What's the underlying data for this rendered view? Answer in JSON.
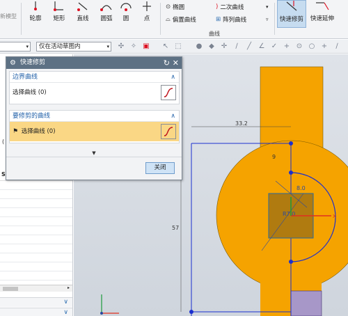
{
  "ribbon": {
    "left_label": "新模型",
    "buttons": [
      {
        "label": "轮廓",
        "icon": "profile-icon"
      },
      {
        "label": "矩形",
        "icon": "rectangle-icon"
      },
      {
        "label": "直线",
        "icon": "line-icon"
      },
      {
        "label": "圆弧",
        "icon": "arc-icon"
      },
      {
        "label": "圆",
        "icon": "circle-icon"
      },
      {
        "label": "点",
        "icon": "point-icon"
      }
    ],
    "small_items": [
      {
        "label": "椭圆",
        "icon": "ellipse-icon"
      },
      {
        "label": "偏置曲线",
        "icon": "offset-curve-icon"
      },
      {
        "label": "二次曲线",
        "icon": "conic-icon"
      },
      {
        "label": "阵列曲线",
        "icon": "pattern-curve-icon"
      }
    ],
    "group_label": "曲线",
    "right_buttons": [
      {
        "label": "快速修剪",
        "icon": "quick-trim-icon",
        "active": true
      },
      {
        "label": "快速延伸",
        "icon": "quick-extend-icon",
        "active": false
      }
    ]
  },
  "toolbar": {
    "filter_value": "仅在活动草图内"
  },
  "left_panel": {
    "stub_text": "(",
    "header_text": "SK"
  },
  "dialog": {
    "title": "快速修剪",
    "sections": [
      {
        "title": "边界曲线",
        "row_label": "选择曲线 (0)"
      },
      {
        "title": "要修剪的曲线",
        "row_label": "选择曲线 (0)"
      }
    ],
    "close_button": "关闭"
  },
  "sketch": {
    "dimensions": [
      "33.2",
      "57",
      "9",
      "8.0",
      "R7.0"
    ],
    "colors": {
      "fill": "#f5a300",
      "constraint_blue": "#1a2fcf",
      "axis_red": "#e03020",
      "axis_green": "#1a9a3a"
    }
  }
}
